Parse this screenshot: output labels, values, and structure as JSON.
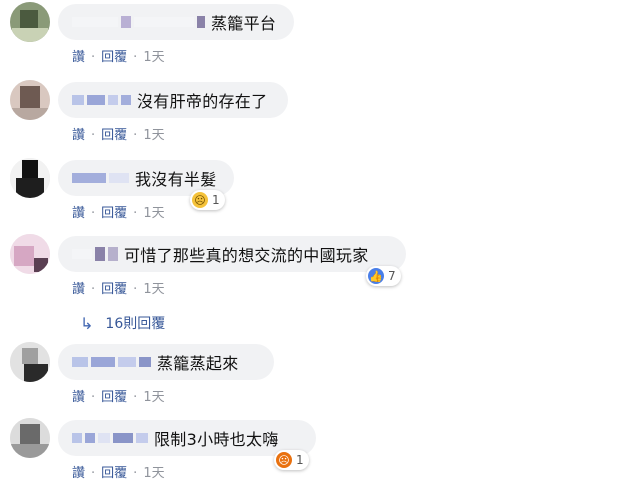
{
  "actions": {
    "like": "讚",
    "reply": "回覆",
    "time": "1天"
  },
  "comments": [
    {
      "text": "蒸籠平台"
    },
    {
      "text": "沒有肝帝的存在了"
    },
    {
      "text": "我沒有半髮",
      "reaction": {
        "icon": "sad-icon",
        "count": "1"
      }
    },
    {
      "text": "可惜了那些真的想交流的中國玩家",
      "reaction": {
        "icon": "like-icon",
        "count": "7"
      }
    },
    {
      "text": "蒸籠蒸起來"
    },
    {
      "text": "限制3小時也太嗨",
      "reaction": {
        "icon": "angry-icon",
        "count": "1"
      }
    }
  ],
  "replies": {
    "label": "16則回覆"
  },
  "colors": {
    "link": "#385898",
    "bubble": "#f1f2f4",
    "like": "#4a7fe8",
    "sad": "#f5c33b",
    "angry": "#e9710f"
  }
}
